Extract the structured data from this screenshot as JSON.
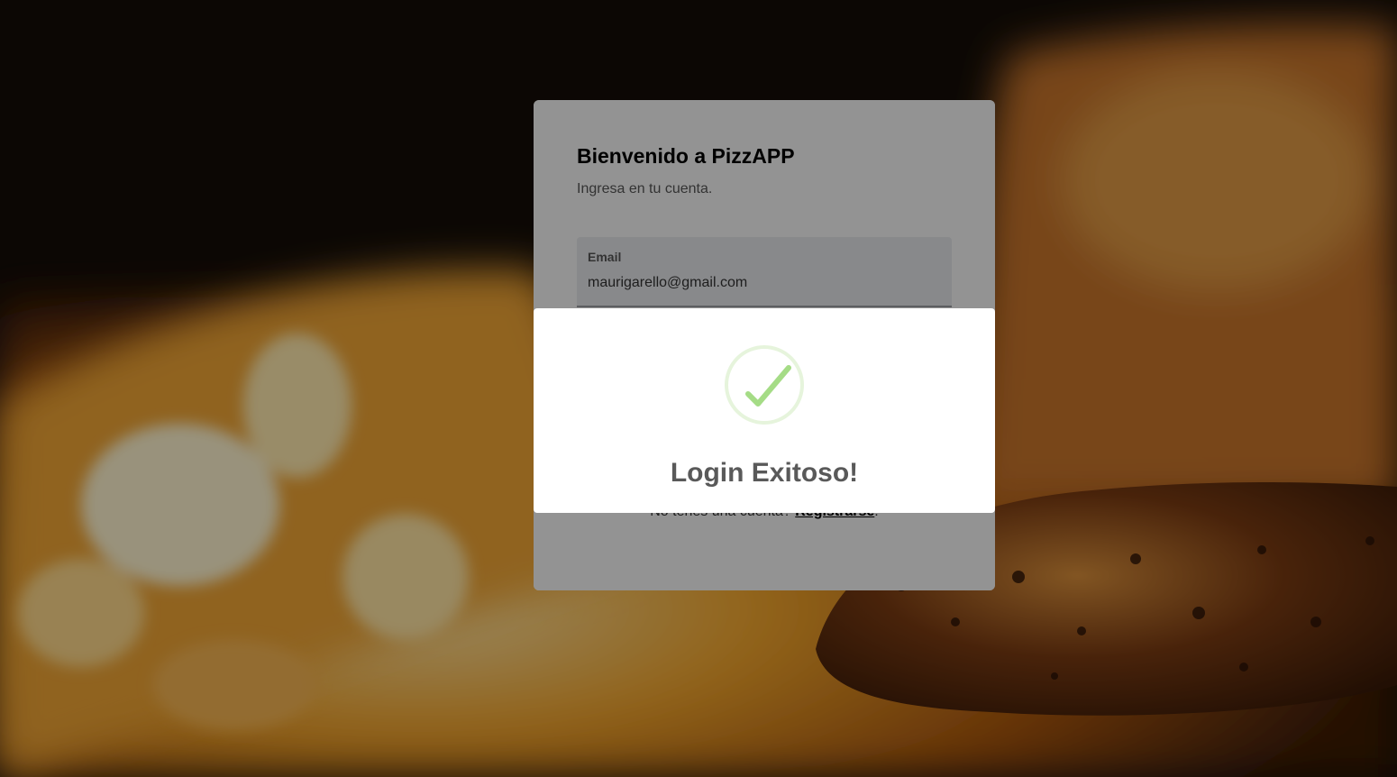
{
  "login": {
    "title": "Bienvenido a PizzAPP",
    "subtitle": "Ingresa en tu cuenta.",
    "email_label": "Email",
    "email_value": "maurigarello@gmail.com",
    "register_prompt": "No tenes una cuenta?",
    "register_link": "Registrarse",
    "register_suffix": "."
  },
  "modal": {
    "icon": "success-check-icon",
    "title": "Login Exitoso!",
    "accent_color": "#a5dc86"
  }
}
